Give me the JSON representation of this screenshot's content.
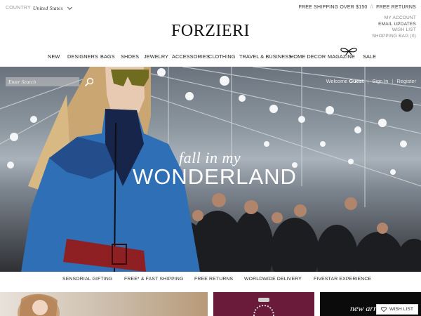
{
  "topbar": {
    "country_label": "COUNTRY",
    "country_value": "United States",
    "promo_shipping": "FREE SHIPPING OVER $150",
    "promo_sep": "//",
    "promo_returns": "FREE RETURNS"
  },
  "account": {
    "my_account": "MY ACCOUNT",
    "email_updates": "EMAIL UPDATES",
    "wish_list": "WISH LIST",
    "shopping_bag": "SHOPPING BAG (0)"
  },
  "logo": "FORZIERI",
  "nav": [
    "NEW",
    "DESIGNERS",
    "BAGS",
    "SHOES",
    "JEWELRY",
    "ACCESSORIES",
    "CLOTHING",
    "TRAVEL & BUSINESS",
    "HOME DECOR",
    "MAGAZINE",
    "SALE"
  ],
  "search": {
    "placeholder": "Enter Search"
  },
  "welcome": {
    "prefix": "Welcome",
    "user": "Guest",
    "sep": "|",
    "sign_in": "Sign In",
    "register": "Register"
  },
  "hero": {
    "line1": "fall in my",
    "line2": "WONDERLAND"
  },
  "benefits": [
    "SENSORIAL GIFTING",
    "FREE* & FAST SHIPPING",
    "FREE RETURNS",
    "WORLDWIDE DELIVERY",
    "FIVESTAR EXPERIENCE"
  ],
  "tiles": {
    "tile3_text": "new arr"
  },
  "wishlist_button": "WISH LIST",
  "colors": {
    "tile2": "#6b1b3a",
    "tile3": "#0b0b0b",
    "jacket": "#2f6fb5"
  },
  "icons": {
    "search": "search-icon",
    "bow": "bow-icon",
    "heart": "heart-icon",
    "chevron": "chevron-down-icon"
  }
}
